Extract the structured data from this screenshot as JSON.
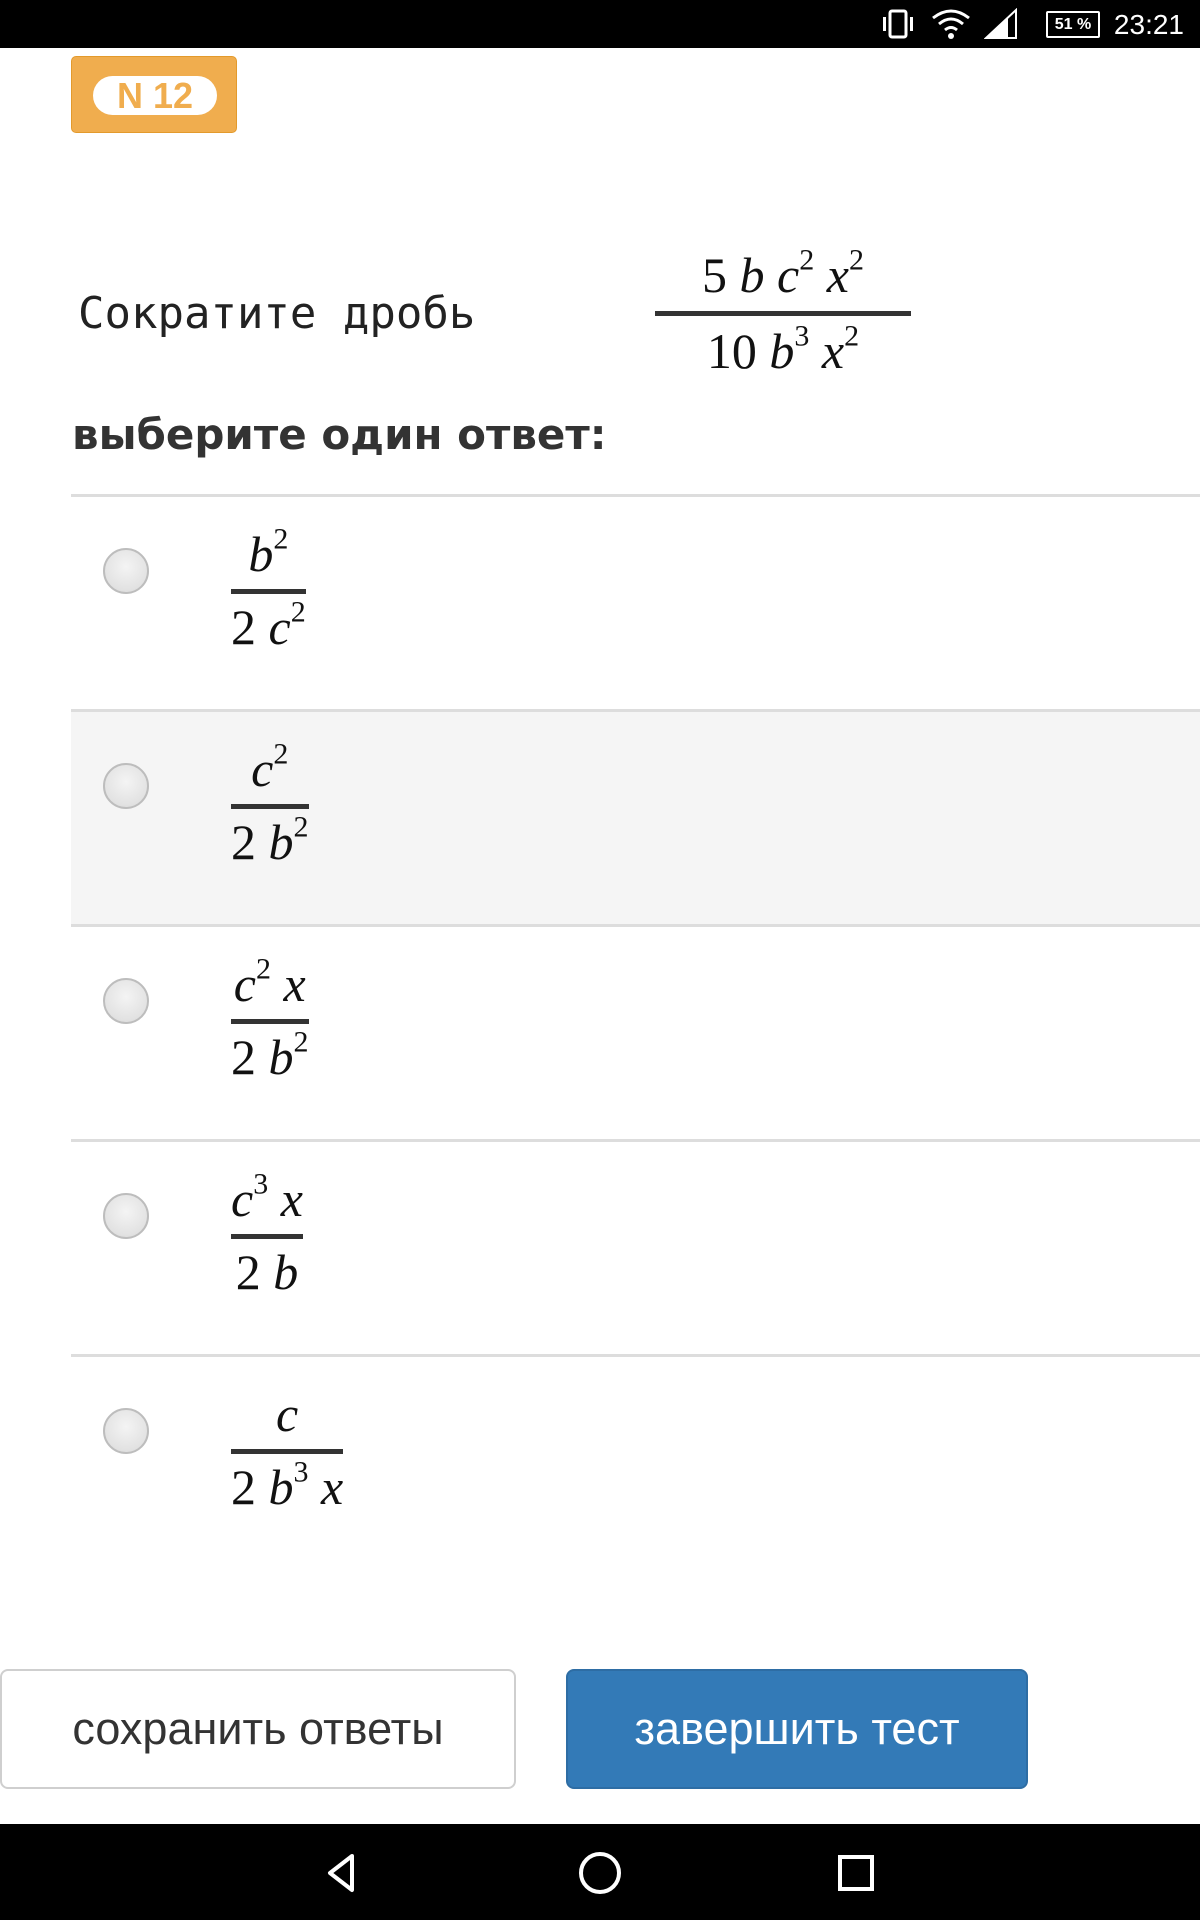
{
  "status_bar": {
    "time": "23:21",
    "battery": "51 %",
    "icons": [
      "vibrate-icon",
      "wifi-icon",
      "signal-icon",
      "battery-icon"
    ]
  },
  "question": {
    "number": "N 12",
    "text": "Сократите дробь",
    "fraction": {
      "numerator": [
        "5 ",
        {
          "i": "b"
        },
        " ",
        {
          "i": "c"
        },
        {
          "sup": "2"
        },
        " ",
        {
          "i": "x"
        },
        {
          "sup": "2"
        }
      ],
      "denominator": [
        "10 ",
        {
          "i": "b"
        },
        {
          "sup": "3"
        },
        " ",
        {
          "i": "x"
        },
        {
          "sup": "2"
        }
      ]
    },
    "prompt": "выберите один ответ:"
  },
  "answers": [
    {
      "numerator": [
        {
          "i": "b"
        },
        {
          "sup": "2"
        }
      ],
      "denominator": [
        "2 ",
        {
          "i": "c"
        },
        {
          "sup": "2"
        }
      ],
      "selected": false
    },
    {
      "numerator": [
        {
          "i": "c"
        },
        {
          "sup": "2"
        }
      ],
      "denominator": [
        "2 ",
        {
          "i": "b"
        },
        {
          "sup": "2"
        }
      ],
      "selected": false
    },
    {
      "numerator": [
        {
          "i": "c"
        },
        {
          "sup": "2"
        },
        " ",
        {
          "i": "x"
        }
      ],
      "denominator": [
        "2 ",
        {
          "i": "b"
        },
        {
          "sup": "2"
        }
      ],
      "selected": false
    },
    {
      "numerator": [
        {
          "i": "c"
        },
        {
          "sup": "3"
        },
        " ",
        {
          "i": "x"
        }
      ],
      "denominator": [
        "2 ",
        {
          "i": "b"
        }
      ],
      "selected": false
    },
    {
      "numerator": [
        {
          "i": "c"
        }
      ],
      "denominator": [
        "2 ",
        {
          "i": "b"
        },
        {
          "sup": "3"
        },
        " ",
        {
          "i": "x"
        }
      ],
      "selected": false
    }
  ],
  "buttons": {
    "save_label": "сохранить ответы",
    "finish_label": "завершить тест"
  },
  "colors": {
    "badge": "#f0ad4e",
    "primary": "#337ab7",
    "highlight_row": "#f5f5f5"
  },
  "nav_bar": {
    "icons": [
      "back-icon",
      "home-icon",
      "recents-icon"
    ]
  }
}
